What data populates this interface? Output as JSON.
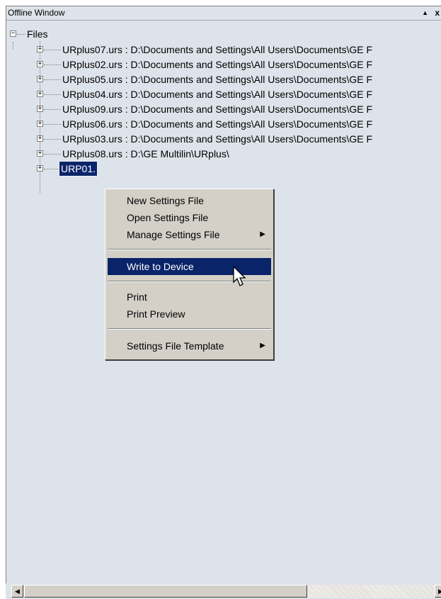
{
  "window": {
    "title": "Offline Window",
    "pin_glyph": "▲",
    "close_glyph": "x"
  },
  "tree": {
    "root": {
      "label": "Files",
      "expander": "−"
    },
    "items": [
      {
        "label": "URplus07.urs : D:\\Documents and Settings\\All Users\\Documents\\GE F",
        "expander": "+"
      },
      {
        "label": "URplus02.urs : D:\\Documents and Settings\\All Users\\Documents\\GE F",
        "expander": "+"
      },
      {
        "label": "URplus05.urs : D:\\Documents and Settings\\All Users\\Documents\\GE F",
        "expander": "+"
      },
      {
        "label": "URplus04.urs : D:\\Documents and Settings\\All Users\\Documents\\GE F",
        "expander": "+"
      },
      {
        "label": "URplus09.urs : D:\\Documents and Settings\\All Users\\Documents\\GE F",
        "expander": "+"
      },
      {
        "label": "URplus06.urs : D:\\Documents and Settings\\All Users\\Documents\\GE F",
        "expander": "+"
      },
      {
        "label": "URplus03.urs : D:\\Documents and Settings\\All Users\\Documents\\GE F",
        "expander": "+"
      },
      {
        "label": "URplus08.urs : D:\\GE Multilin\\URplus\\",
        "expander": "+"
      },
      {
        "label": "URP01.",
        "expander": "+",
        "selected": true
      }
    ]
  },
  "context_menu": {
    "items": [
      {
        "label": "New Settings File"
      },
      {
        "label": "Open Settings File"
      },
      {
        "label": "Manage Settings File",
        "arrow": "▶"
      },
      {
        "label": "Write to Device",
        "active": true
      },
      {
        "label": "Print"
      },
      {
        "label": "Print Preview"
      },
      {
        "label": "Settings File Template",
        "arrow": "▶"
      }
    ]
  },
  "scrollbar": {
    "left_glyph": "◀",
    "right_glyph": "▶"
  },
  "colors": {
    "selection": "#0a246a",
    "panel_bg": "#dde3ea",
    "menu_bg": "#d4d0c8"
  }
}
